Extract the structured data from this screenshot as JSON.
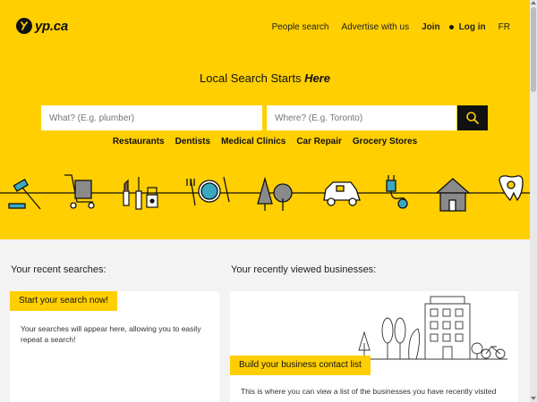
{
  "header": {
    "logo_text": "yp.ca",
    "nav": {
      "people_search": "People search",
      "advertise": "Advertise with us",
      "join": "Join",
      "login": "Log in",
      "language": "FR"
    }
  },
  "hero": {
    "tagline_prefix": "Local Search Starts ",
    "tagline_emphasis": "Here",
    "search": {
      "what_placeholder": "What? (E.g. plumber)",
      "where_placeholder": "Where? (E.g. Toronto)"
    },
    "categories": [
      "Restaurants",
      "Dentists",
      "Medical Clinics",
      "Car Repair",
      "Grocery Stores"
    ]
  },
  "recent_searches": {
    "title": "Your recent searches:",
    "tag": "Start your search now!",
    "text": "Your searches will appear here, allowing you to easily repeat a search!"
  },
  "recently_viewed": {
    "title": "Your recently viewed businesses:",
    "tag": "Build your business contact list",
    "text": "This is where you can view a list of the businesses you have recently visited"
  },
  "colors": {
    "brand_yellow": "#ffcf01",
    "dark": "#111111"
  }
}
